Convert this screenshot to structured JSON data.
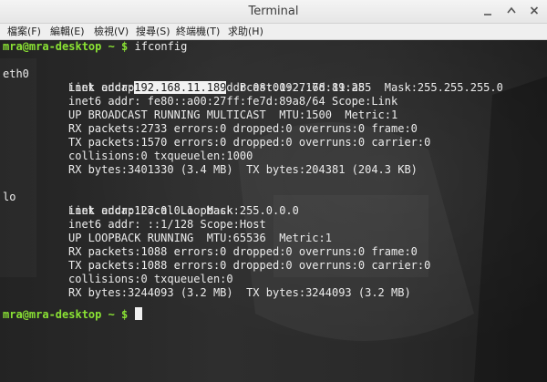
{
  "window": {
    "title": "Terminal"
  },
  "menu": [
    "檔案(F)",
    "編輯(E)",
    "檢視(V)",
    "搜尋(S)",
    "終端機(T)",
    "求助(H)"
  ],
  "colors": {
    "prompt": "#8ae234",
    "terminal_text": "#ececec",
    "terminal_bg": "#2a2a2a",
    "highlight_bg": "#f2f2f2"
  },
  "terminal": {
    "prompt": "mra@mra-desktop ~ $",
    "command": "ifconfig",
    "eth0": {
      "name": "eth0",
      "link": "Link encap:Ethernet  HWaddr 08:00:27:7d:89:a8",
      "inet_prefix": "inet addr:",
      "inet_addr": "192.168.11.189",
      "inet_suffix": "  Bcast:192.168.11.255  Mask:255.255.255.0",
      "inet6": "inet6 addr: fe80::a00:27ff:fe7d:89a8/64 Scope:Link",
      "flags": "UP BROADCAST RUNNING MULTICAST  MTU:1500  Metric:1",
      "rx_packets": "RX packets:2733 errors:0 dropped:0 overruns:0 frame:0",
      "tx_packets": "TX packets:1570 errors:0 dropped:0 overruns:0 carrier:0",
      "collisions": "collisions:0 txqueuelen:1000",
      "bytes": "RX bytes:3401330 (3.4 MB)  TX bytes:204381 (204.3 KB)"
    },
    "lo": {
      "name": "lo",
      "link": "Link encap:Local Loopback",
      "inet": "inet addr:127.0.0.1  Mask:255.0.0.0",
      "inet6": "inet6 addr: ::1/128 Scope:Host",
      "flags": "UP LOOPBACK RUNNING  MTU:65536  Metric:1",
      "rx_packets": "RX packets:1088 errors:0 dropped:0 overruns:0 frame:0",
      "tx_packets": "TX packets:1088 errors:0 dropped:0 overruns:0 carrier:0",
      "collisions": "collisions:0 txqueuelen:0",
      "bytes": "RX bytes:3244093 (3.2 MB)  TX bytes:3244093 (3.2 MB)"
    },
    "final_prompt": "mra@mra-desktop ~ $"
  }
}
